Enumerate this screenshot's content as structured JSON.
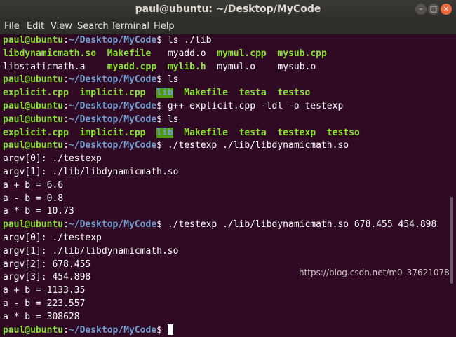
{
  "window": {
    "title": "paul@ubuntu: ~/Desktop/MyCode"
  },
  "menu": [
    "File",
    "Edit",
    "View",
    "Search",
    "Terminal",
    "Help"
  ],
  "colors": {
    "background": "#300a24",
    "prompt_user": "#8ae234",
    "prompt_path": "#729fcf",
    "executable": "#8ae234",
    "directory": "#729fcf",
    "text": "#ffffff"
  },
  "prompt": {
    "user_host": "paul@ubuntu",
    "path": "~/Desktop/MyCode"
  },
  "terminal": [
    {
      "command": "ls ./lib"
    },
    {
      "files": "libdynamicmath.so  Makefile   myadd.o  mymul.cpp  mysub.cpp"
    },
    {
      "files": "libstaticmath.a    myadd.cpp  mylib.h  mymul.o    mysub.o"
    },
    {
      "command": "ls"
    },
    {
      "files": "explicit.cpp  implicit.cpp  lib  Makefile  testa  testso"
    },
    {
      "command": "g++ explicit.cpp -ldl -o testexp"
    },
    {
      "command": "ls"
    },
    {
      "files": "explicit.cpp  implicit.cpp  lib  Makefile  testa  testexp  testso"
    },
    {
      "command": "./testexp ./lib/libdynamicmath.so"
    },
    {
      "output": "argv[0]: ./testexp"
    },
    {
      "output": "argv[1]: ./lib/libdynamicmath.so"
    },
    {
      "output": "a + b = 6.6"
    },
    {
      "output": "a - b = 0.8"
    },
    {
      "output": "a * b = 10.73"
    },
    {
      "command": "./testexp ./lib/libdynamicmath.so 678.455 454.898"
    },
    {
      "output": "argv[0]: ./testexp"
    },
    {
      "output": "argv[1]: ./lib/libdynamicmath.so"
    },
    {
      "output": "argv[2]: 678.455"
    },
    {
      "output": "argv[3]: 454.898"
    },
    {
      "output": "a + b = 1133.35"
    },
    {
      "output": "a - b = 223.557"
    },
    {
      "output": "a * b = 308628"
    },
    {
      "command": ""
    }
  ],
  "watermark": "https://blog.csdn.net/m0_37621078"
}
